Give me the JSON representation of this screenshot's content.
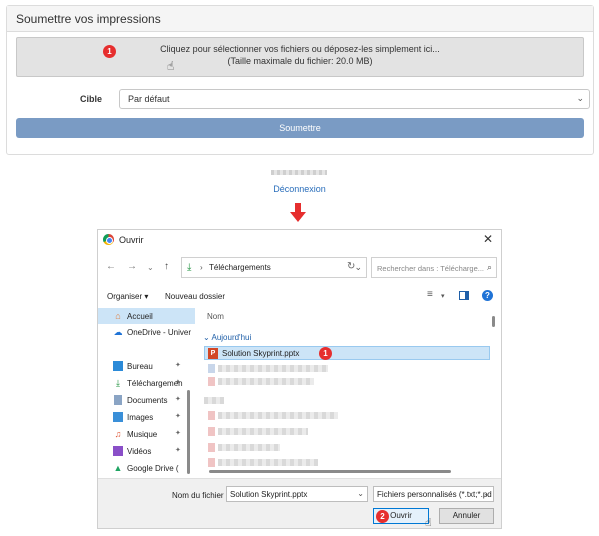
{
  "panel": {
    "title": "Soumettre vos impressions",
    "dropzone_line1": "Cliquez pour sélectionner vos fichiers ou déposez-les simplement ici...",
    "dropzone_line2": "(Taille maximale du fichier: 20.0 MB)",
    "step_badge": "1",
    "target_label": "Cible",
    "target_value": "Par défaut",
    "submit_label": "Soumettre"
  },
  "logout_label": "Déconnexion",
  "dialog": {
    "title": "Ouvrir",
    "address_path": "Téléchargements",
    "search_placeholder": "Rechercher dans : Télécharge...",
    "organize_label": "Organiser",
    "new_folder_label": "Nouveau dossier",
    "nav_items": [
      {
        "label": "Accueil",
        "icon": "home-icon",
        "pinned": false
      },
      {
        "label": "OneDrive - Univer",
        "icon": "cloud-icon",
        "pinned": false
      },
      {
        "label": "Bureau",
        "icon": "desktop-icon",
        "pinned": true
      },
      {
        "label": "Téléchargemen",
        "icon": "download-icon",
        "pinned": true
      },
      {
        "label": "Documents",
        "icon": "documents-icon",
        "pinned": true
      },
      {
        "label": "Images",
        "icon": "images-icon",
        "pinned": true
      },
      {
        "label": "Musique",
        "icon": "music-icon",
        "pinned": true
      },
      {
        "label": "Vidéos",
        "icon": "videos-icon",
        "pinned": true
      },
      {
        "label": "Google Drive (",
        "icon": "google-drive-icon",
        "pinned": false
      }
    ],
    "column_name": "Nom",
    "group_today": "Aujourd'hui",
    "selected_file": "Solution Skyprint.pptx",
    "file_badge": "1",
    "filename_label": "Nom du fichier :",
    "filename_value": "Solution Skyprint.pptx",
    "filter_value": "Fichiers personnalisés (*.txt;*.pd",
    "open_label": "Ouvrir",
    "open_badge": "2",
    "cancel_label": "Annuler"
  },
  "colors": {
    "badge": "#e62e2e",
    "submit": "#7a9bc4",
    "link": "#2a6ebb",
    "selection": "#cce4f7"
  }
}
